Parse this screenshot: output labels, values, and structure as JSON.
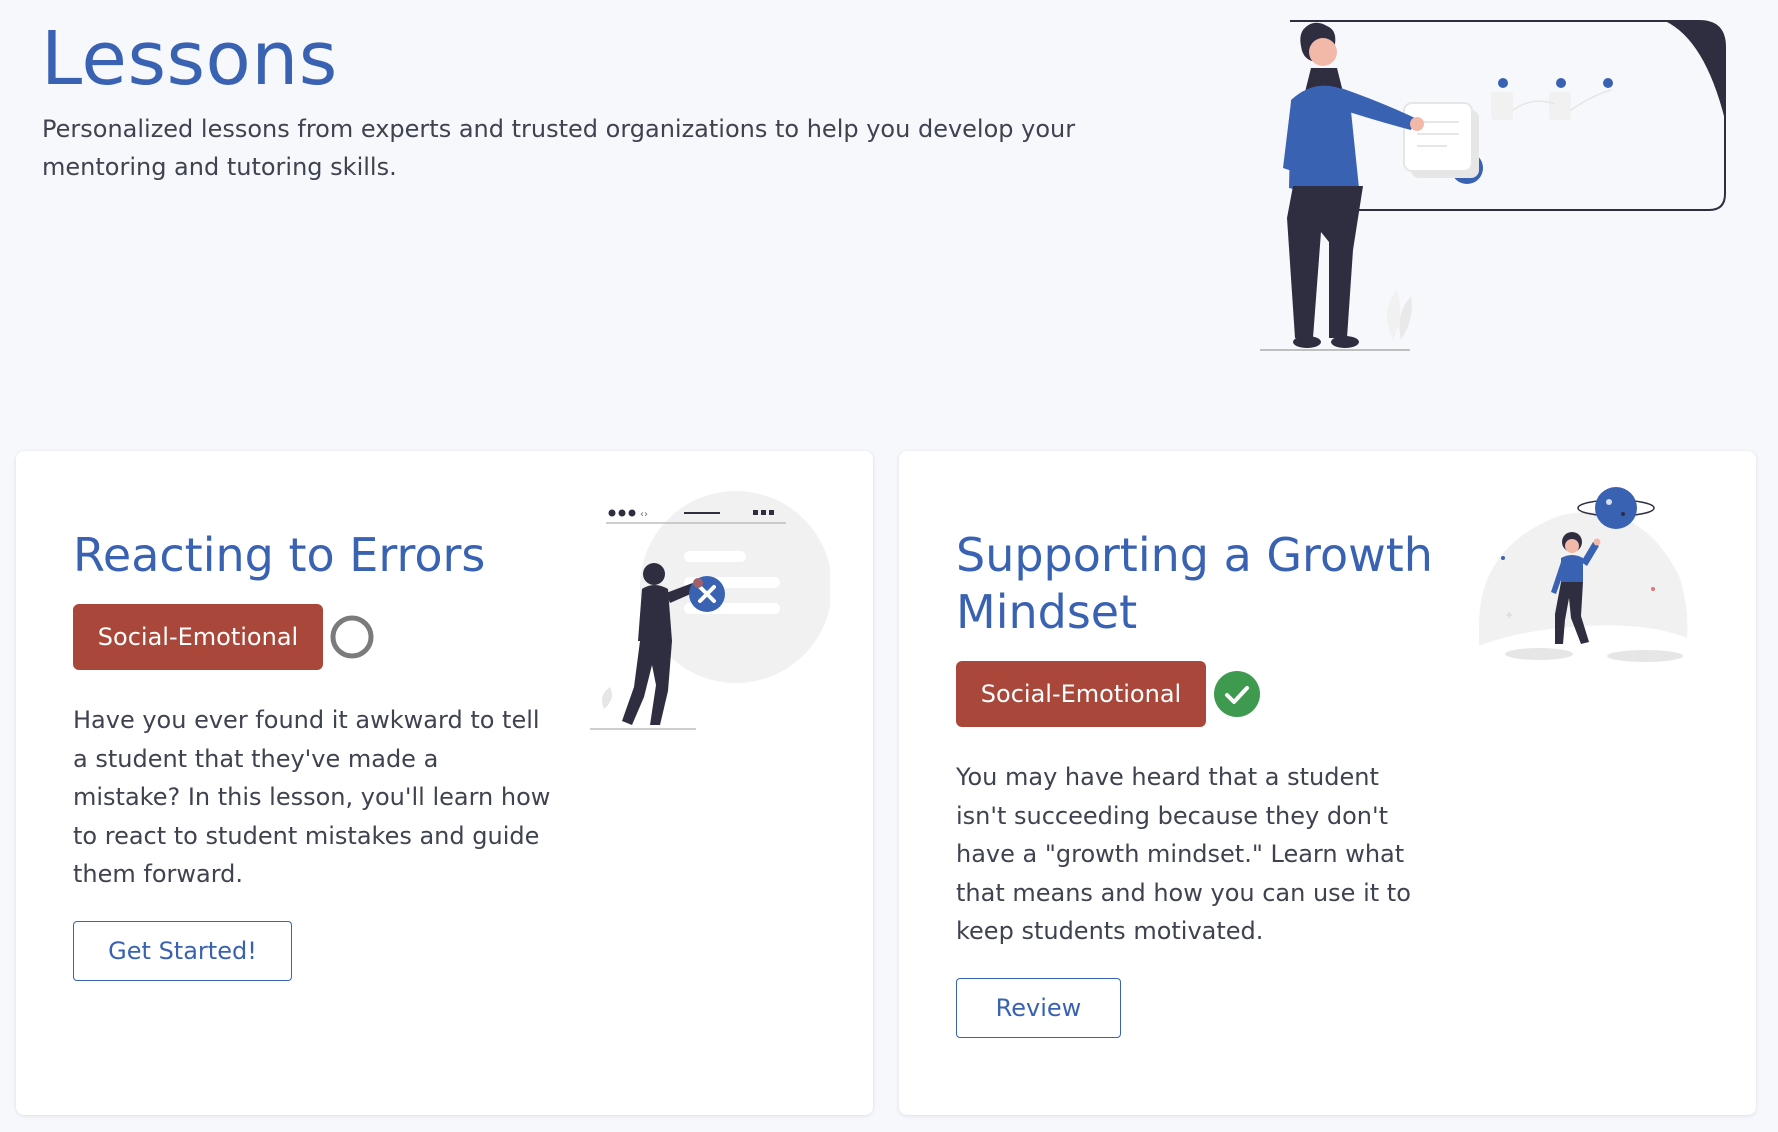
{
  "header": {
    "title": "Lessons",
    "subtitle": "Personalized lessons from experts and trusted organizations to help you develop your mentoring and tutoring skills."
  },
  "lessons": [
    {
      "title": "Reacting to Errors",
      "tag": "Social-Emotional",
      "status": "not-started",
      "status_icon": "empty-circle-icon",
      "description": "Have you ever found it awkward to tell a student that they've made a mistake? In this lesson, you'll learn how to react to student mistakes and guide them forward.",
      "button_label": "Get Started!"
    },
    {
      "title": "Supporting a Growth Mindset",
      "tag": "Social-Emotional",
      "status": "completed",
      "status_icon": "check-circle-icon",
      "description": "You may have heard that a student isn't succeeding because they don't have a \"growth mindset.\" Learn what that means and how you can use it to keep students motivated.",
      "button_label": "Review"
    }
  ],
  "colors": {
    "brand_blue": "#3a62b3",
    "tag_red": "#a9473b",
    "success_green": "#3d9a4e",
    "page_bg": "#f7f8fc"
  }
}
